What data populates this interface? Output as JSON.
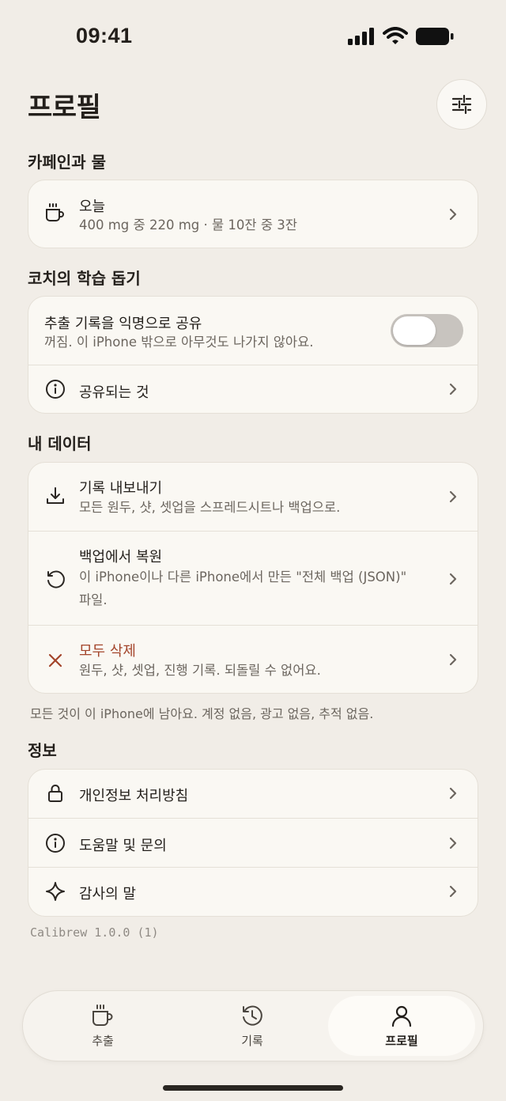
{
  "status_bar": {
    "time": "09:41"
  },
  "header": {
    "title": "프로필"
  },
  "sections": {
    "caffeine": {
      "title": "카페인과 물",
      "today": {
        "label": "오늘",
        "detail": "400 mg 중 220 mg · 물 10잔 중 3잔"
      }
    },
    "coach": {
      "title": "코치의 학습 돕기",
      "share": {
        "label": "추출 기록을 익명으로 공유",
        "detail": "꺼짐. 이 iPhone 밖으로 아무것도 나가지 않아요.",
        "enabled": false
      },
      "whats_shared": {
        "label": "공유되는 것"
      }
    },
    "data": {
      "title": "내 데이터",
      "export": {
        "label": "기록 내보내기",
        "detail": "모든 원두, 샷, 셋업을 스프레드시트나 백업으로."
      },
      "restore": {
        "label": "백업에서 복원",
        "detail": "이 iPhone이나 다른 iPhone에서 만든 \"전체 백업 (JSON)\" 파일."
      },
      "delete_all": {
        "label": "모두 삭제",
        "detail": "원두, 샷, 셋업, 진행 기록. 되돌릴 수 없어요."
      },
      "footnote": "모든 것이 이 iPhone에 남아요. 계정 없음, 광고 없음, 추적 없음."
    },
    "info": {
      "title": "정보",
      "privacy": {
        "label": "개인정보 처리방침"
      },
      "help": {
        "label": "도움말 및 문의"
      },
      "thanks": {
        "label": "감사의 말"
      }
    }
  },
  "version": "Calibrew 1.0.0 (1)",
  "tab_bar": {
    "tabs": [
      {
        "label": "추출",
        "icon": "cup-icon",
        "active": false
      },
      {
        "label": "기록",
        "icon": "history-icon",
        "active": false
      },
      {
        "label": "프로필",
        "icon": "person-icon",
        "active": true
      }
    ]
  },
  "colors": {
    "background": "#f1ede7",
    "card": "#faf8f3",
    "destructive": "#a3442a",
    "text": "#231f1b",
    "secondary": "#6c665f"
  }
}
